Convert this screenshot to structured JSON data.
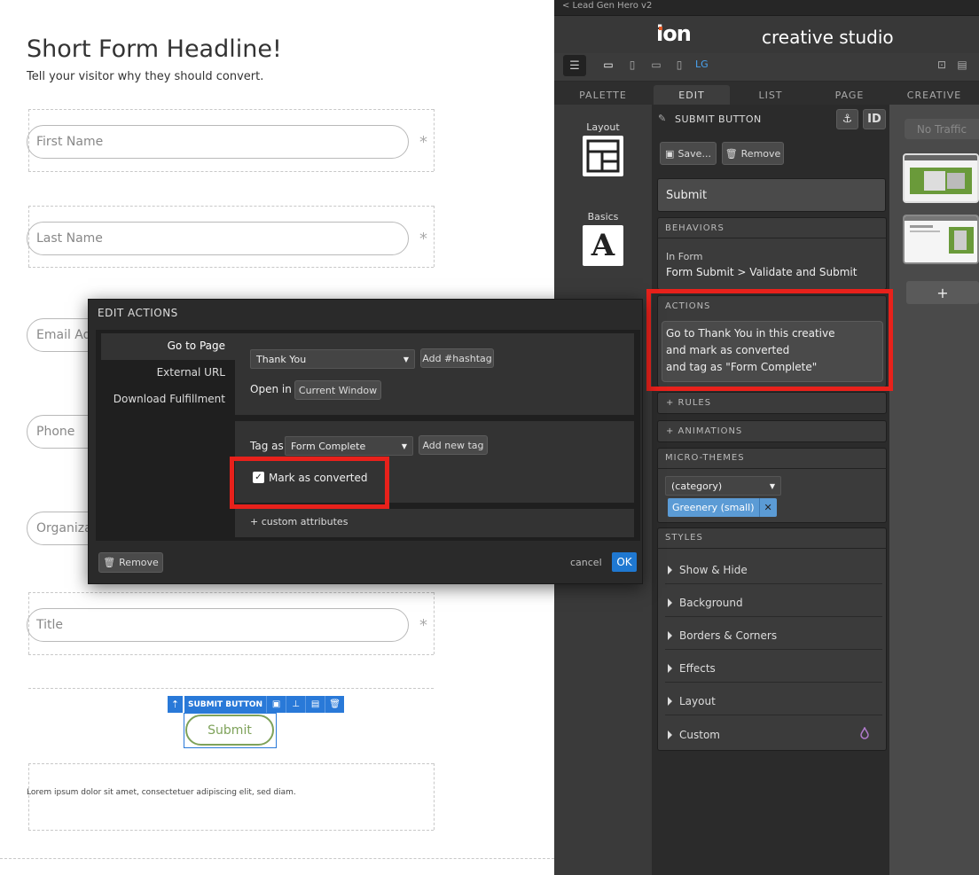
{
  "canvas": {
    "headline": "Short Form Headline!",
    "subhead": "Tell your visitor why they should convert.",
    "fields": [
      {
        "placeholder": "First Name"
      },
      {
        "placeholder": "Last Name"
      },
      {
        "placeholder": "Email Add"
      },
      {
        "placeholder": "Phone"
      },
      {
        "placeholder": "Organizat"
      },
      {
        "placeholder": "Title"
      }
    ],
    "required_mark": "*",
    "submit_toolbar_label": "SUBMIT BUTTON",
    "submit_label": "Submit",
    "lorem": "Lorem ipsum dolor sit amet, consectetuer adipiscing elit, sed diam."
  },
  "studio": {
    "back_link": "< Lead Gen Hero v2",
    "logo": "ion",
    "title": "creative studio",
    "device_lg": "LG",
    "tabs": [
      "PALETTE",
      "EDIT",
      "LIST",
      "PAGE",
      "CREATIVE"
    ],
    "palette": {
      "layout_label": "Layout",
      "basics_label": "Basics",
      "basics_glyph": "A"
    },
    "creative": {
      "no_traffic": "No Traffic",
      "add": "+"
    },
    "edit": {
      "header": "SUBMIT BUTTON",
      "id_label": "ID",
      "save_label": "Save...",
      "remove_label": "Remove",
      "button_text": "Submit",
      "behaviors": {
        "title": "BEHAVIORS",
        "context": "In Form",
        "value": "Form Submit > Validate and Submit"
      },
      "actions": {
        "title": "ACTIONS",
        "line1": "Go to Thank You in this creative",
        "line2": "and mark as converted",
        "line3": "and tag as \"Form Complete\""
      },
      "rules": "+ RULES",
      "animations": "+ ANIMATIONS",
      "micro_themes": {
        "title": "MICRO-THEMES",
        "select": "(category)",
        "tag": "Greenery (small)",
        "tag_remove": "✕"
      },
      "styles": {
        "title": "STYLES",
        "items": [
          "Show & Hide",
          "Background",
          "Borders & Corners",
          "Effects",
          "Layout",
          "Custom"
        ]
      }
    }
  },
  "dialog": {
    "title": "EDIT ACTIONS",
    "nav": [
      "Go to Page",
      "External URL",
      "Download Fulfillment"
    ],
    "page_select": "Thank You",
    "add_hashtag": "Add #hashtag",
    "open_in_label": "Open in",
    "open_in_value": "Current Window",
    "tag_as_label": "Tag as",
    "tag_select": "Form Complete",
    "add_new_tag": "Add new tag",
    "mark_converted": "Mark as converted",
    "custom_attributes": "+ custom attributes",
    "remove": "Remove",
    "cancel": "cancel",
    "ok": "OK"
  },
  "colors": {
    "highlight": "#e8211b",
    "accent": "#1f78d1",
    "submit_green": "#7ea25a"
  }
}
